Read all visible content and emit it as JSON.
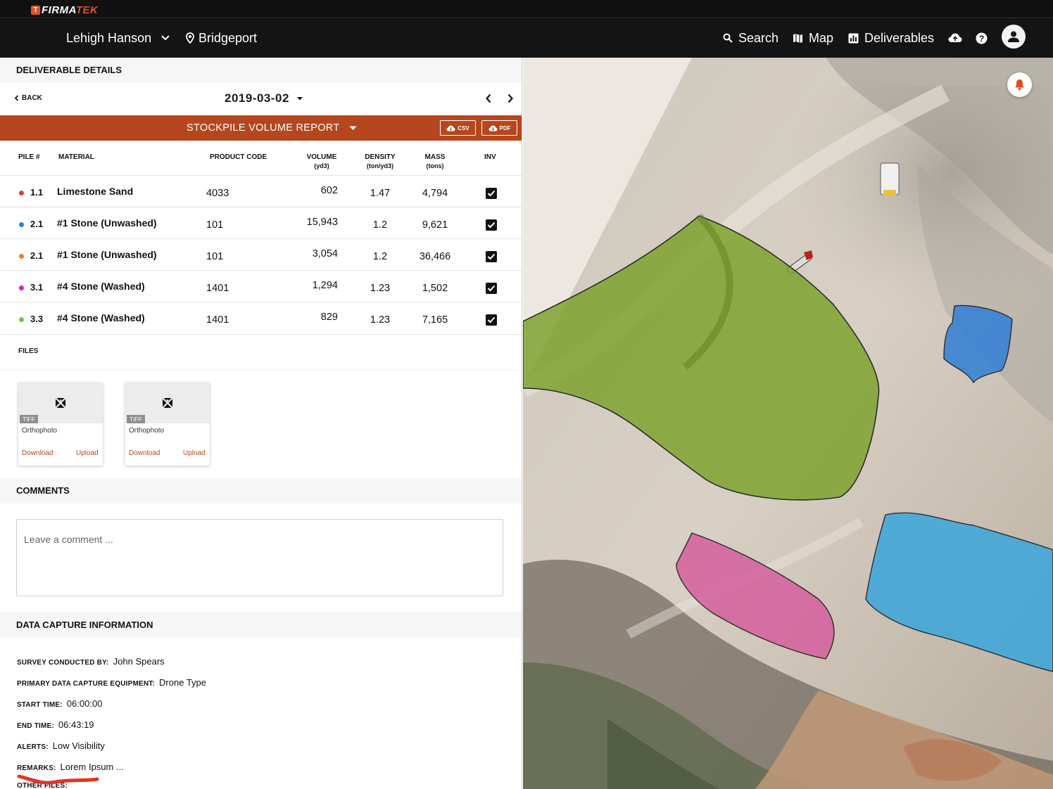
{
  "brand": {
    "mark": "T",
    "name_a": "FIRMA",
    "name_b": "TEK"
  },
  "nav": {
    "company": "Lehigh Hanson",
    "location": "Bridgeport",
    "search": "Search",
    "map": "Map",
    "deliverables": "Deliverables"
  },
  "details": {
    "header": "DELIVERABLE DETAILS",
    "back": "BACK",
    "date": "2019-03-02",
    "report": "STOCKPILE VOLUME REPORT",
    "csv": "CSV",
    "pdf": "PDF"
  },
  "table": {
    "headers": {
      "pile": "PILE #",
      "material": "MATERIAL",
      "code": "PRODUCT CODE",
      "volume": "VOLUME",
      "volume_unit": "(yd3)",
      "density": "DENSITY",
      "density_unit": "(ton/yd3)",
      "mass": "MASS",
      "mass_unit": "(tons)",
      "inv": "INV"
    },
    "rows": [
      {
        "pile": "1.1",
        "color": "#e53935",
        "material": "Limestone Sand",
        "code": "4033",
        "volume": "602",
        "density": "1.47",
        "mass": "4,794",
        "inv": true
      },
      {
        "pile": "2.1",
        "color": "#1e88e5",
        "material": "#1 Stone (Unwashed)",
        "code": "101",
        "volume": "15,943",
        "density": "1.2",
        "mass": "9,621",
        "inv": true
      },
      {
        "pile": "2.1",
        "color": "#f57c1f",
        "material": "#1 Stone (Unwashed)",
        "code": "101",
        "volume": "3,054",
        "density": "1.2",
        "mass": "36,466",
        "inv": true
      },
      {
        "pile": "3.1",
        "color": "#d81bd8",
        "material": "#4 Stone (Washed)",
        "code": "1401",
        "volume": "1,294",
        "density": "1.23",
        "mass": "1,502",
        "inv": true
      },
      {
        "pile": "3.3",
        "color": "#6bc92a",
        "material": "#4 Stone (Washed)",
        "code": "1401",
        "volume": "829",
        "density": "1.23",
        "mass": "7,165",
        "inv": true
      }
    ]
  },
  "files": {
    "label": "FILES",
    "items": [
      {
        "type": "TIFF",
        "name": "Orthophoto",
        "download": "Download",
        "upload": "Upload"
      },
      {
        "type": "TIFF",
        "name": "Orthophoto",
        "download": "Download",
        "upload": "Upload"
      }
    ]
  },
  "comments": {
    "header": "COMMENTS",
    "placeholder": "Leave a comment ..."
  },
  "capture": {
    "header": "DATA CAPTURE INFORMATION",
    "fields": [
      {
        "key": "SURVEY CONDUCTED BY:",
        "value": "John Spears"
      },
      {
        "key": "PRIMARY DATA CAPTURE EQUIPMENT:",
        "value": "Drone Type"
      },
      {
        "key": "START TIME:",
        "value": "06:00:00"
      },
      {
        "key": "END TIME:",
        "value": "06:43:19"
      },
      {
        "key": "ALERTS:",
        "value": "Low Visibility"
      },
      {
        "key": "REMARKS:",
        "value": "Lorem Ipsum ..."
      },
      {
        "key": "OTHER FILES:",
        "value": ""
      }
    ]
  },
  "map": {
    "polygons": [
      {
        "pile": "3.3",
        "color": "#7aa12a"
      },
      {
        "pile": "2.1",
        "color": "#2f7fd6"
      },
      {
        "pile": "3.1",
        "color": "#d65a9c"
      },
      {
        "pile": "2.1",
        "color": "#3aa6dc"
      }
    ]
  }
}
